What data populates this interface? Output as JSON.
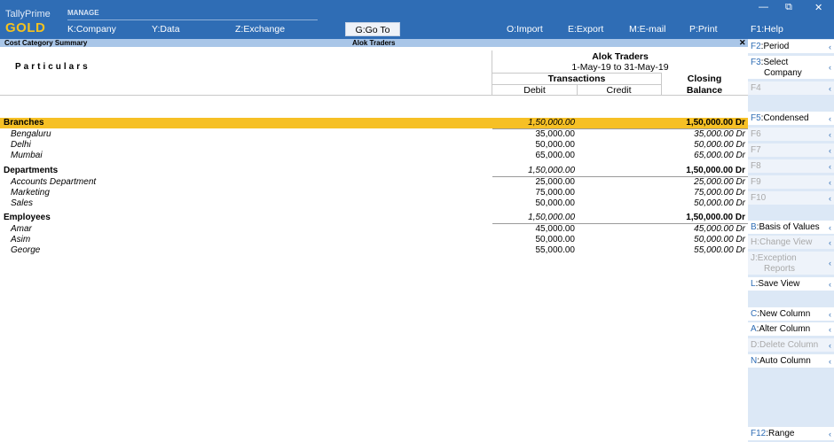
{
  "brand": {
    "line1": "TallyPrime",
    "line2": "GOLD"
  },
  "manage": "MANAGE",
  "menu": {
    "company": {
      "key": "K",
      "label": ":Company"
    },
    "data": {
      "key": "Y",
      "label": ":Data"
    },
    "exchange": {
      "key": "Z",
      "label": ":Exchange"
    },
    "goto": {
      "key": "G",
      "label": ":Go To"
    },
    "import": {
      "key": "O",
      "label": ":Import"
    },
    "export": {
      "key": "E",
      "label": ":Export"
    },
    "email": {
      "key": "M",
      "label": ":E-mail"
    },
    "print": {
      "key": "P",
      "label": ":Print"
    },
    "help": {
      "key": "F1",
      "label": ":Help"
    }
  },
  "window_controls": {
    "minimize": "—",
    "restore": "⧉",
    "close": "✕"
  },
  "title_strip": {
    "left": "Cost Category Summary",
    "center": "Alok Traders",
    "close": "✕"
  },
  "report": {
    "particulars_header": "Particulars",
    "company": "Alok Traders",
    "period": "1-May-19 to 31-May-19",
    "transactions": "Transactions",
    "debit": "Debit",
    "credit": "Credit",
    "closing_line1": "Closing",
    "closing_line2": "Balance",
    "rows": [
      {
        "type": "group",
        "name": "Branches",
        "debit": "1,50,000.00",
        "closing": "1,50,000.00 Dr"
      },
      {
        "type": "child",
        "name": "Bengaluru",
        "debit": "35,000.00",
        "closing": "35,000.00 Dr"
      },
      {
        "type": "child",
        "name": "Delhi",
        "debit": "50,000.00",
        "closing": "50,000.00 Dr"
      },
      {
        "type": "child",
        "name": "Mumbai",
        "debit": "65,000.00",
        "closing": "65,000.00 Dr"
      },
      {
        "type": "group",
        "name": "Departments",
        "debit": "1,50,000.00",
        "closing": "1,50,000.00 Dr"
      },
      {
        "type": "child",
        "name": "Accounts Department",
        "debit": "25,000.00",
        "closing": "25,000.00 Dr"
      },
      {
        "type": "child",
        "name": "Marketing",
        "debit": "75,000.00",
        "closing": "75,000.00 Dr"
      },
      {
        "type": "child",
        "name": "Sales",
        "debit": "50,000.00",
        "closing": "50,000.00 Dr"
      },
      {
        "type": "group",
        "name": "Employees",
        "debit": "1,50,000.00",
        "closing": "1,50,000.00 Dr"
      },
      {
        "type": "child",
        "name": "Amar",
        "debit": "45,000.00",
        "closing": "45,000.00 Dr"
      },
      {
        "type": "child",
        "name": "Asim",
        "debit": "50,000.00",
        "closing": "50,000.00 Dr"
      },
      {
        "type": "child",
        "name": "George",
        "debit": "55,000.00",
        "closing": "55,000.00 Dr"
      }
    ]
  },
  "right_panel": {
    "f2": {
      "key": "F2",
      "label": ":Period"
    },
    "f3": {
      "key": "F3",
      "label": ":Select",
      "label2": "Company"
    },
    "f4": {
      "key": "F4",
      "label": ""
    },
    "f5": {
      "key": "F5",
      "label": ":Condensed"
    },
    "f6": {
      "key": "F6",
      "label": ""
    },
    "f7": {
      "key": "F7",
      "label": ""
    },
    "f8": {
      "key": "F8",
      "label": ""
    },
    "f9": {
      "key": "F9",
      "label": ""
    },
    "f10": {
      "key": "F10",
      "label": ""
    },
    "b": {
      "key": "B",
      "label": ":Basis of Values"
    },
    "h": {
      "key": "H",
      "label": ":Change View"
    },
    "j": {
      "key": "J",
      "label": ":Exception",
      "label2": "Reports"
    },
    "l": {
      "key": "L",
      "label": ":Save View"
    },
    "c": {
      "key": "C",
      "label": ":New Column"
    },
    "a": {
      "key": "A",
      "label": ":Alter Column"
    },
    "d": {
      "key": "D",
      "label": ":Delete Column"
    },
    "n": {
      "key": "N",
      "label": ":Auto Column"
    },
    "f12": {
      "key": "F12",
      "label": ":Range"
    }
  },
  "colors": {
    "topbar": "#2f6db5",
    "highlight": "#f6c025",
    "brand_gold": "#f4c21f",
    "panel": "#dce8f6"
  }
}
